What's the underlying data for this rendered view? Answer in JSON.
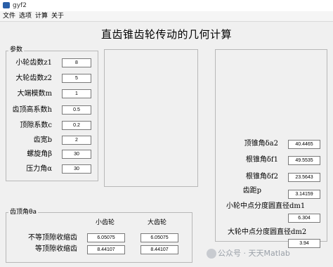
{
  "window": {
    "title": "gyf2"
  },
  "menu": [
    "文件",
    "选项",
    "计算",
    "关于"
  ],
  "main_title": "直齿锥齿轮传动的几何计算",
  "params": {
    "group_label": "参数",
    "rows": [
      {
        "label": "小轮齿数z1",
        "value": "8"
      },
      {
        "label": "大轮齿数z2",
        "value": "5"
      },
      {
        "label": "大端模数m",
        "value": "1"
      },
      {
        "label": "齿顶高系数h",
        "value": "0.5"
      },
      {
        "label": "顶隙系数c",
        "value": "0.2"
      },
      {
        "label": "齿宽b",
        "value": "2"
      },
      {
        "label": "螺旋角β",
        "value": "30"
      },
      {
        "label": "压力角α",
        "value": "30"
      }
    ]
  },
  "results": {
    "rows": [
      {
        "label": "顶锥角δa2",
        "value": "40.4465"
      },
      {
        "label": "根锥角δf1",
        "value": "49.5535"
      },
      {
        "label": "根锥角δf2",
        "value": "23.5643"
      },
      {
        "label": "齿距p",
        "value": "3.14159"
      },
      {
        "label": "小轮中点分度圆直径dm1",
        "value": "6.304"
      },
      {
        "label": "大轮中点分度圆直径dm2",
        "value": "3.94"
      }
    ]
  },
  "theta": {
    "group_label": "齿顶角θa",
    "col_small": "小齿轮",
    "col_large": "大齿轮",
    "rows": [
      {
        "label": "不等顶隙收缩齿",
        "small": "6.05075",
        "large": "6.05075"
      },
      {
        "label": "等顶隙收缩齿",
        "small": "8.44107",
        "large": "8.44107"
      }
    ]
  },
  "watermark": "公众号 · 天天Matlab",
  "icons": {
    "app": "matlab-figure-icon",
    "watermark": "wechat-icon"
  }
}
